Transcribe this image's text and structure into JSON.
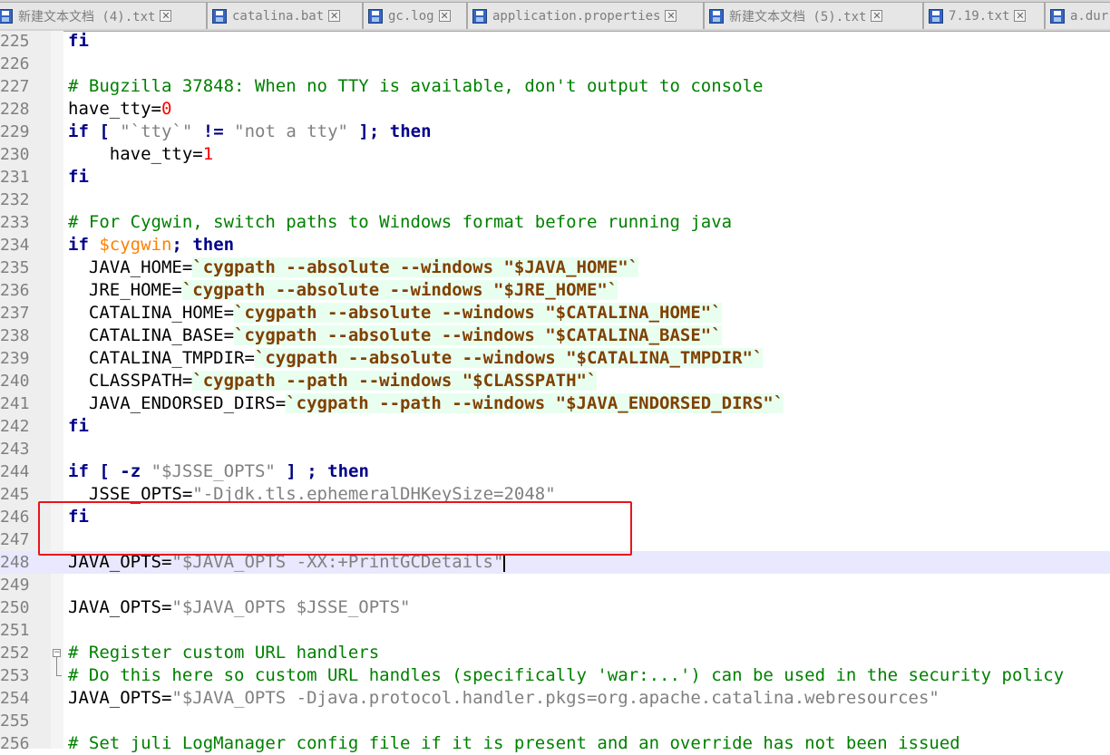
{
  "tabs": [
    {
      "label": "新建文本文档 (4).txt",
      "icon": "save-disk-icon"
    },
    {
      "label": "catalina.bat",
      "icon": "save-disk-icon"
    },
    {
      "label": "gc.log",
      "icon": "save-disk-icon"
    },
    {
      "label": "application.properties",
      "icon": "save-disk-icon"
    },
    {
      "label": "新建文本文档 (5).txt",
      "icon": "save-disk-icon"
    },
    {
      "label": "7.19.txt",
      "icon": "save-disk-icon"
    },
    {
      "label": "a.dur",
      "icon": "save-disk-icon"
    }
  ],
  "tab_close_glyph": "✕",
  "colors": {
    "comment": "#008000",
    "keyword": "#00008b",
    "number": "#ff0000",
    "variable": "#ff8000",
    "string": "#808080",
    "backtick": "#804000",
    "current_line": "#e8e8ff",
    "annotation_box": "#e8141c"
  },
  "editor": {
    "current_line": "248",
    "lines": [
      {
        "no": "225",
        "tokens": [
          {
            "t": "kw",
            "v": "fi"
          }
        ]
      },
      {
        "no": "226",
        "tokens": []
      },
      {
        "no": "227",
        "tokens": [
          {
            "t": "cmt",
            "v": "# Bugzilla 37848: When no TTY is available, don't output to console"
          }
        ]
      },
      {
        "no": "228",
        "tokens": [
          {
            "t": "plain",
            "v": "have_tty="
          },
          {
            "t": "num",
            "v": "0"
          }
        ]
      },
      {
        "no": "229",
        "tokens": [
          {
            "t": "kw",
            "v": "if"
          },
          {
            "t": "plain",
            "v": " "
          },
          {
            "t": "op",
            "v": "["
          },
          {
            "t": "plain",
            "v": " "
          },
          {
            "t": "str",
            "v": "\"`tty`\""
          },
          {
            "t": "plain",
            "v": " "
          },
          {
            "t": "op",
            "v": "!="
          },
          {
            "t": "plain",
            "v": " "
          },
          {
            "t": "str",
            "v": "\"not a tty\""
          },
          {
            "t": "plain",
            "v": " "
          },
          {
            "t": "op",
            "v": "];"
          },
          {
            "t": "plain",
            "v": " "
          },
          {
            "t": "kw",
            "v": "then"
          }
        ]
      },
      {
        "no": "230",
        "tokens": [
          {
            "t": "plain",
            "v": "    have_tty="
          },
          {
            "t": "num",
            "v": "1"
          }
        ]
      },
      {
        "no": "231",
        "tokens": [
          {
            "t": "kw",
            "v": "fi"
          }
        ]
      },
      {
        "no": "232",
        "tokens": []
      },
      {
        "no": "233",
        "tokens": [
          {
            "t": "cmt",
            "v": "# For Cygwin, switch paths to Windows format before running java"
          }
        ]
      },
      {
        "no": "234",
        "tokens": [
          {
            "t": "kw",
            "v": "if"
          },
          {
            "t": "plain",
            "v": " "
          },
          {
            "t": "var",
            "v": "$cygwin"
          },
          {
            "t": "op",
            "v": ";"
          },
          {
            "t": "plain",
            "v": " "
          },
          {
            "t": "kw",
            "v": "then"
          }
        ]
      },
      {
        "no": "235",
        "tokens": [
          {
            "t": "plain",
            "v": "  JAVA_HOME="
          },
          {
            "t": "bt",
            "v": "`cygpath --absolute --windows \"$JAVA_HOME\"`"
          }
        ]
      },
      {
        "no": "236",
        "tokens": [
          {
            "t": "plain",
            "v": "  JRE_HOME="
          },
          {
            "t": "bt",
            "v": "`cygpath --absolute --windows \"$JRE_HOME\"`"
          }
        ]
      },
      {
        "no": "237",
        "tokens": [
          {
            "t": "plain",
            "v": "  CATALINA_HOME="
          },
          {
            "t": "bt",
            "v": "`cygpath --absolute --windows \"$CATALINA_HOME\"`"
          }
        ]
      },
      {
        "no": "238",
        "tokens": [
          {
            "t": "plain",
            "v": "  CATALINA_BASE="
          },
          {
            "t": "bt",
            "v": "`cygpath --absolute --windows \"$CATALINA_BASE\"`"
          }
        ]
      },
      {
        "no": "239",
        "tokens": [
          {
            "t": "plain",
            "v": "  CATALINA_TMPDIR="
          },
          {
            "t": "bt",
            "v": "`cygpath --absolute --windows \"$CATALINA_TMPDIR\"`"
          }
        ]
      },
      {
        "no": "240",
        "tokens": [
          {
            "t": "plain",
            "v": "  CLASSPATH="
          },
          {
            "t": "bt",
            "v": "`cygpath --path --windows \"$CLASSPATH\"`"
          }
        ]
      },
      {
        "no": "241",
        "tokens": [
          {
            "t": "plain",
            "v": "  JAVA_ENDORSED_DIRS="
          },
          {
            "t": "bt",
            "v": "`cygpath --path --windows \"$JAVA_ENDORSED_DIRS\"`"
          }
        ]
      },
      {
        "no": "242",
        "tokens": [
          {
            "t": "kw",
            "v": "fi"
          }
        ]
      },
      {
        "no": "243",
        "tokens": []
      },
      {
        "no": "244",
        "tokens": [
          {
            "t": "kw",
            "v": "if"
          },
          {
            "t": "plain",
            "v": " "
          },
          {
            "t": "op",
            "v": "["
          },
          {
            "t": "plain",
            "v": " "
          },
          {
            "t": "op",
            "v": "-z"
          },
          {
            "t": "plain",
            "v": " "
          },
          {
            "t": "str",
            "v": "\"$JSSE_OPTS\""
          },
          {
            "t": "plain",
            "v": " "
          },
          {
            "t": "op",
            "v": "]"
          },
          {
            "t": "plain",
            "v": " "
          },
          {
            "t": "op",
            "v": ";"
          },
          {
            "t": "plain",
            "v": " "
          },
          {
            "t": "kw",
            "v": "then"
          }
        ]
      },
      {
        "no": "245",
        "tokens": [
          {
            "t": "plain",
            "v": "  JSSE_OPTS="
          },
          {
            "t": "str",
            "v": "\"-Djdk.tls.ephemeralDHKeySize=2048\""
          }
        ]
      },
      {
        "no": "246",
        "tokens": [
          {
            "t": "kw",
            "v": "fi"
          }
        ]
      },
      {
        "no": "247",
        "tokens": []
      },
      {
        "no": "248",
        "tokens": [
          {
            "t": "plain",
            "v": "JAVA_OPTS="
          },
          {
            "t": "str",
            "v": "\"$JAVA_OPTS -XX:+PrintGCDetails\""
          }
        ],
        "caret": true
      },
      {
        "no": "249",
        "tokens": []
      },
      {
        "no": "250",
        "tokens": [
          {
            "t": "plain",
            "v": "JAVA_OPTS="
          },
          {
            "t": "str",
            "v": "\"$JAVA_OPTS $JSSE_OPTS\""
          }
        ]
      },
      {
        "no": "251",
        "tokens": []
      },
      {
        "no": "252",
        "tokens": [
          {
            "t": "cmt",
            "v": "# Register custom URL handlers"
          }
        ],
        "fold": "start"
      },
      {
        "no": "253",
        "tokens": [
          {
            "t": "cmt",
            "v": "# Do this here so custom URL handles (specifically 'war:...') can be used in the security policy"
          }
        ],
        "fold": "end"
      },
      {
        "no": "254",
        "tokens": [
          {
            "t": "plain",
            "v": "JAVA_OPTS="
          },
          {
            "t": "str",
            "v": "\"$JAVA_OPTS -Djava.protocol.handler.pkgs=org.apache.catalina.webresources\""
          }
        ]
      },
      {
        "no": "255",
        "tokens": []
      },
      {
        "no": "256",
        "tokens": [
          {
            "t": "cmt",
            "v": "# Set juli LogManager config file if it is present and an override has not been issued"
          }
        ]
      }
    ]
  }
}
